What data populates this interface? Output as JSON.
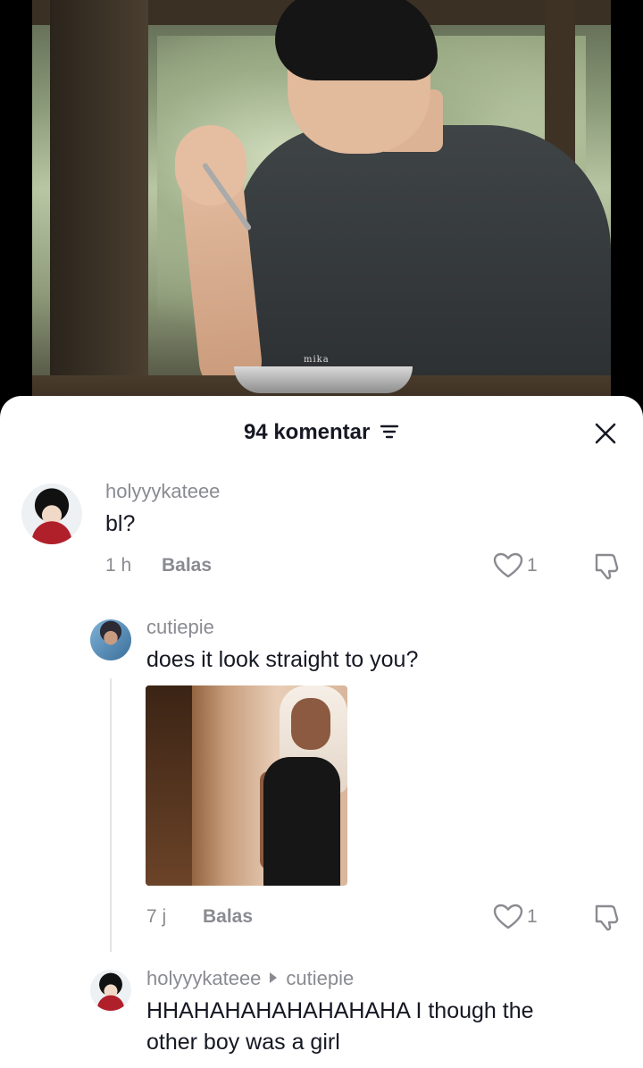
{
  "video": {
    "watermark": "mika"
  },
  "comments_sheet": {
    "title": "94 komentar",
    "comments": [
      {
        "username": "holyyykateee",
        "text": "bl?",
        "time": "1 h",
        "reply_label": "Balas",
        "likes": "1"
      },
      {
        "username": "cutiepie",
        "text": "does it look straight to you?",
        "time": "7 j",
        "reply_label": "Balas",
        "likes": "1"
      },
      {
        "username": "holyyykateee",
        "reply_to": "cutiepie",
        "text_line1": "HHAHAHAHAHAHAHAHA I though the",
        "text_line2": "other boy was a girl"
      }
    ]
  }
}
